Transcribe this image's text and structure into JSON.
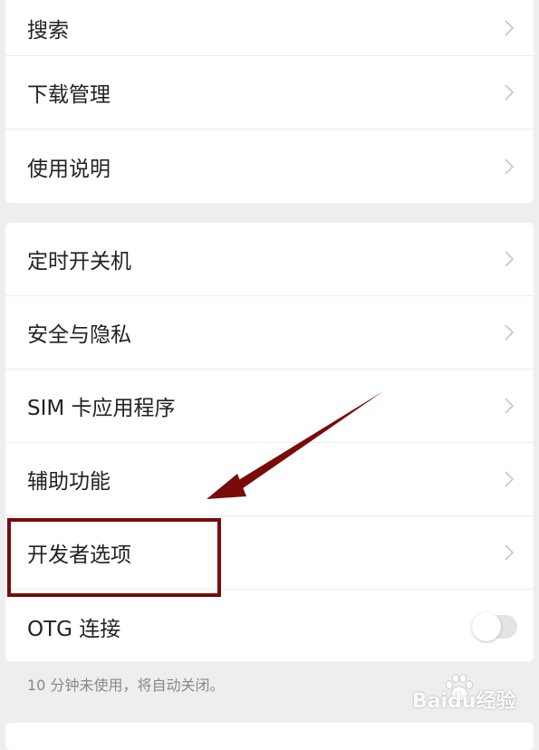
{
  "settings": {
    "group_top": [
      {
        "label": "搜索"
      },
      {
        "label": "下载管理"
      },
      {
        "label": "使用说明"
      }
    ],
    "group_main": [
      {
        "label": "定时开关机"
      },
      {
        "label": "安全与隐私"
      },
      {
        "label": "SIM 卡应用程序"
      },
      {
        "label": "辅助功能"
      },
      {
        "label": "开发者选项"
      },
      {
        "label": "OTG 连接",
        "toggle_on": false
      }
    ],
    "footnote": "10 分钟未使用，将自动关闭。"
  },
  "annotation": {
    "highlight_color": "#7a0b0b",
    "highlight_target": "开发者选项"
  },
  "watermark": {
    "text": "Baidu经验"
  },
  "colors": {
    "background": "#eeeeee",
    "card": "#ffffff",
    "chevron": "#c7c7c7",
    "toggle_track": "#e4e4e4"
  },
  "icons": {
    "row_chevron": "chevron-right-icon",
    "annotation_arrow": "arrow-icon"
  }
}
